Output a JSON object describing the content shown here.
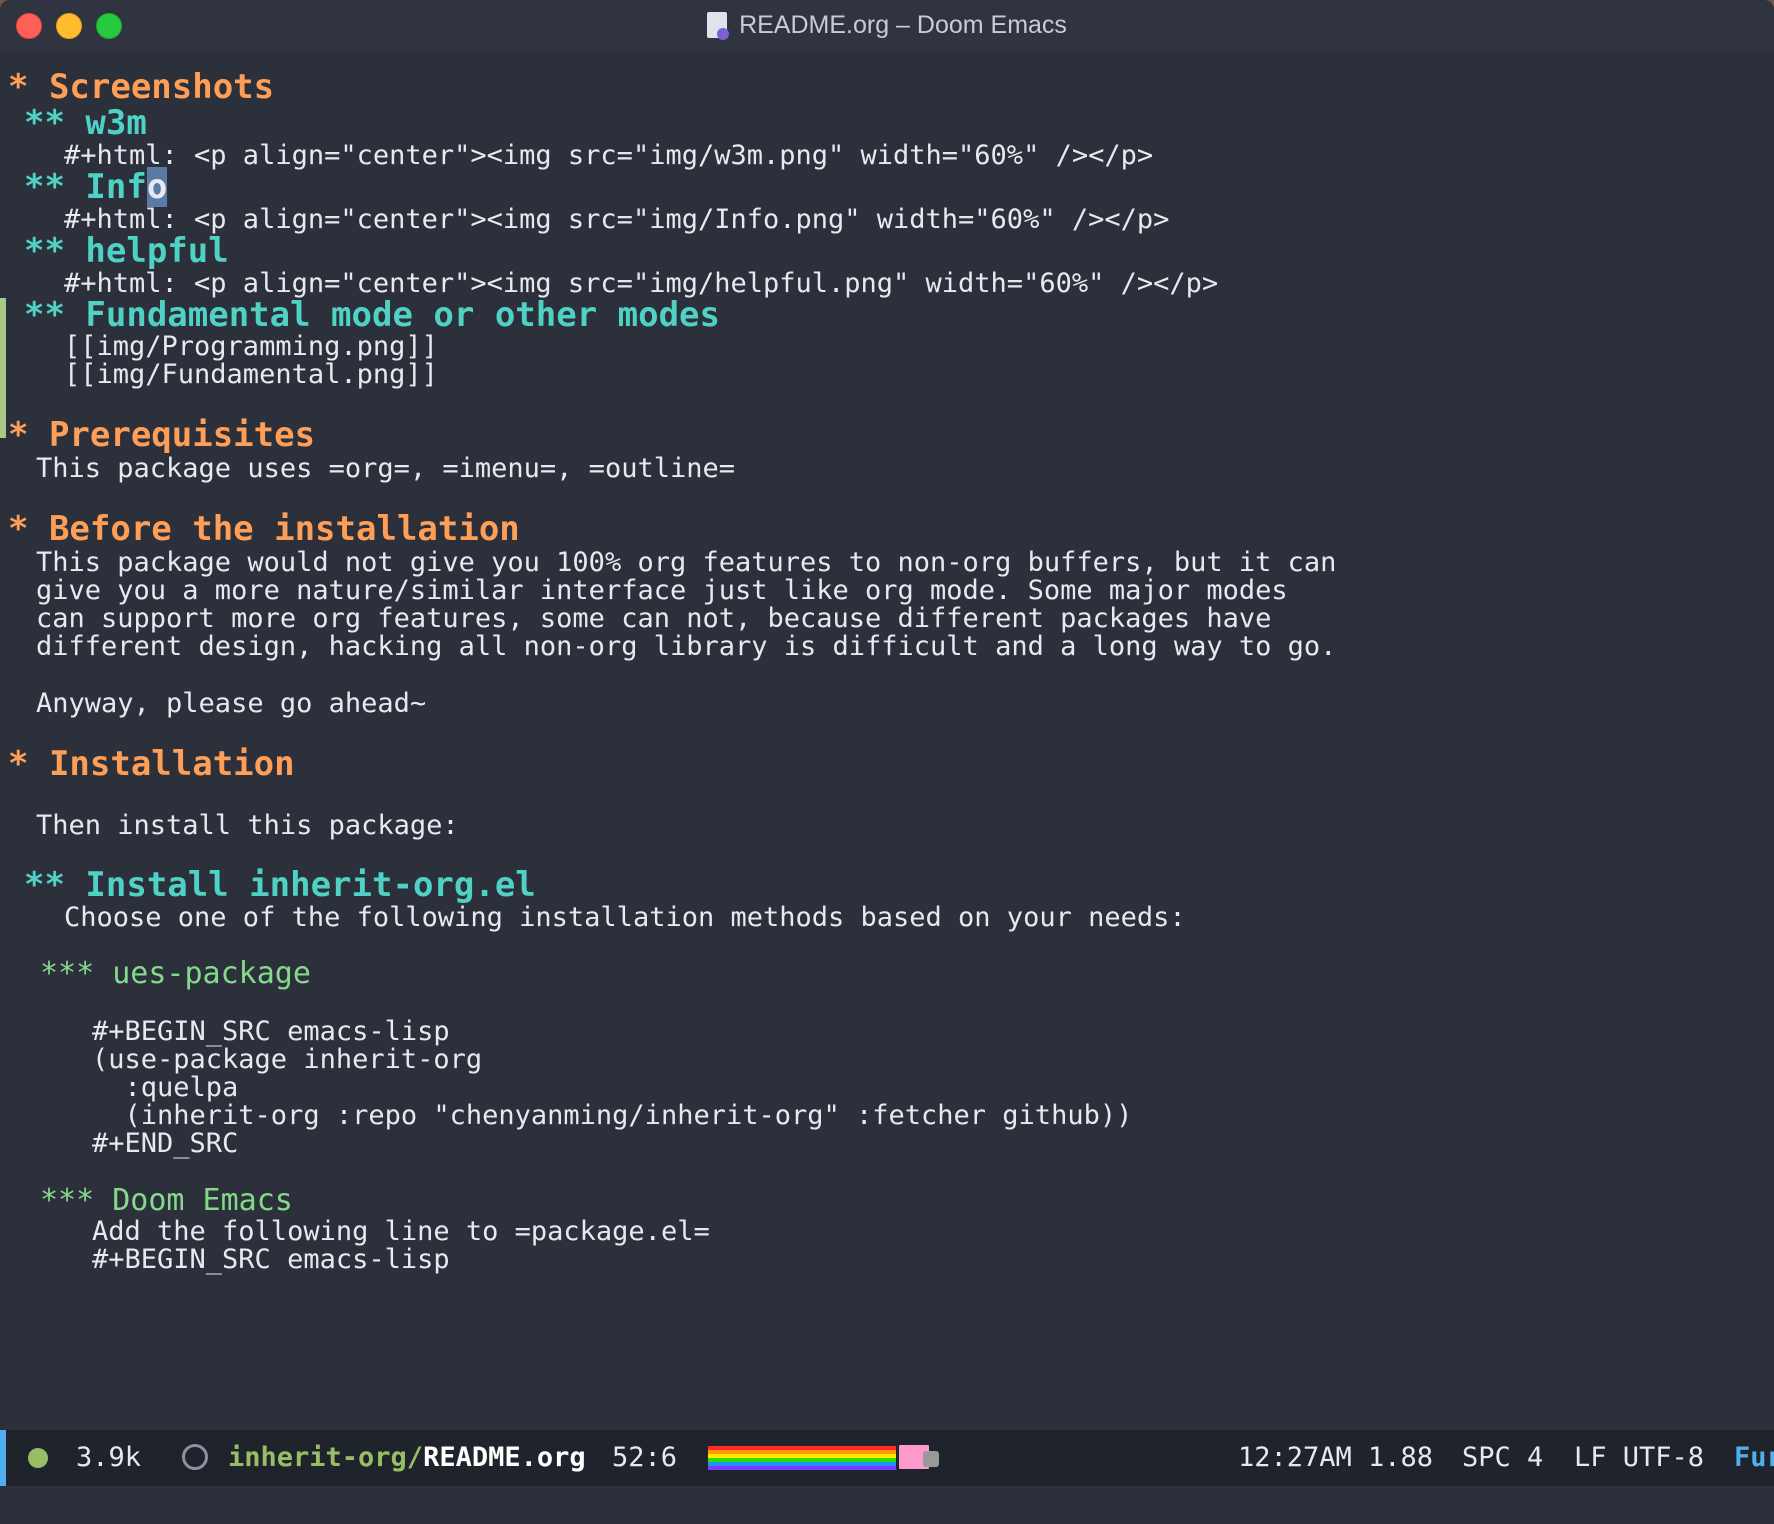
{
  "window": {
    "title": "README.org – Doom Emacs"
  },
  "lines": {
    "l1": {
      "stars": "* ",
      "text": "Screenshots"
    },
    "l2": {
      "stars": "** ",
      "text": "w3m"
    },
    "l3": {
      "text": "#+html: <p align=\"center\"><img src=\"img/w3m.png\" width=\"60%\" /></p>"
    },
    "l4": {
      "stars": "** ",
      "text": "Inf",
      "cursor": "o"
    },
    "l5": {
      "text": "#+html: <p align=\"center\"><img src=\"img/Info.png\" width=\"60%\" /></p>"
    },
    "l6": {
      "stars": "** ",
      "text": "helpful"
    },
    "l7": {
      "text": "#+html: <p align=\"center\"><img src=\"img/helpful.png\" width=\"60%\" /></p>"
    },
    "l8": {
      "stars": "** ",
      "text": "Fundamental mode or other modes"
    },
    "l9": {
      "text": "[[img/Programming.png]]"
    },
    "l10": {
      "text": "[[img/Fundamental.png]]"
    },
    "l11": {
      "stars": "* ",
      "text": "Prerequisites"
    },
    "l12": {
      "text": "This package uses =org=, =imenu=, =outline="
    },
    "l13": {
      "stars": "* ",
      "text": "Before the installation"
    },
    "l14": {
      "text": "This package would not give you 100% org features to non-org buffers, but it can"
    },
    "l15": {
      "text": "give you a more nature/similar interface just like org mode. Some major modes"
    },
    "l16": {
      "text": "can support more org features, some can not, because different packages have"
    },
    "l17": {
      "text": "different design, hacking all non-org library is difficult and a long way to go."
    },
    "l18": {
      "text": "Anyway, please go ahead~"
    },
    "l19": {
      "stars": "* ",
      "text": "Installation"
    },
    "l20": {
      "text": "Then install this package:"
    },
    "l21": {
      "stars": "** ",
      "text": "Install inherit-org.el"
    },
    "l22": {
      "text": "Choose one of the following installation methods based on your needs:"
    },
    "l23": {
      "stars": "*** ",
      "text": "ues-package"
    },
    "l24": {
      "text": "#+BEGIN_SRC emacs-lisp"
    },
    "l25": {
      "text": "(use-package inherit-org"
    },
    "l26": {
      "text": "  :quelpa"
    },
    "l27": {
      "text": "  (inherit-org :repo \"chenyanming/inherit-org\" :fetcher github))"
    },
    "l28": {
      "text": "#+END_SRC"
    },
    "l29": {
      "stars": "*** ",
      "text": "Doom Emacs"
    },
    "l30": {
      "text": "Add the following line to =package.el="
    },
    "l31": {
      "text": "#+BEGIN_SRC emacs-lisp"
    }
  },
  "modeline": {
    "size": "3.9k",
    "project": "inherit-org/",
    "file": "README.org",
    "position": "52:6",
    "time_load": "12:27AM 1.88",
    "indent": "SPC 4",
    "encoding": "LF UTF-8",
    "mode_truncated": "Fur"
  },
  "colors": {
    "background": "#2b303b",
    "level1": "#ff9e57",
    "level2": "#4fd1c5",
    "level3": "#85d98a",
    "text": "#e6e9ef"
  }
}
